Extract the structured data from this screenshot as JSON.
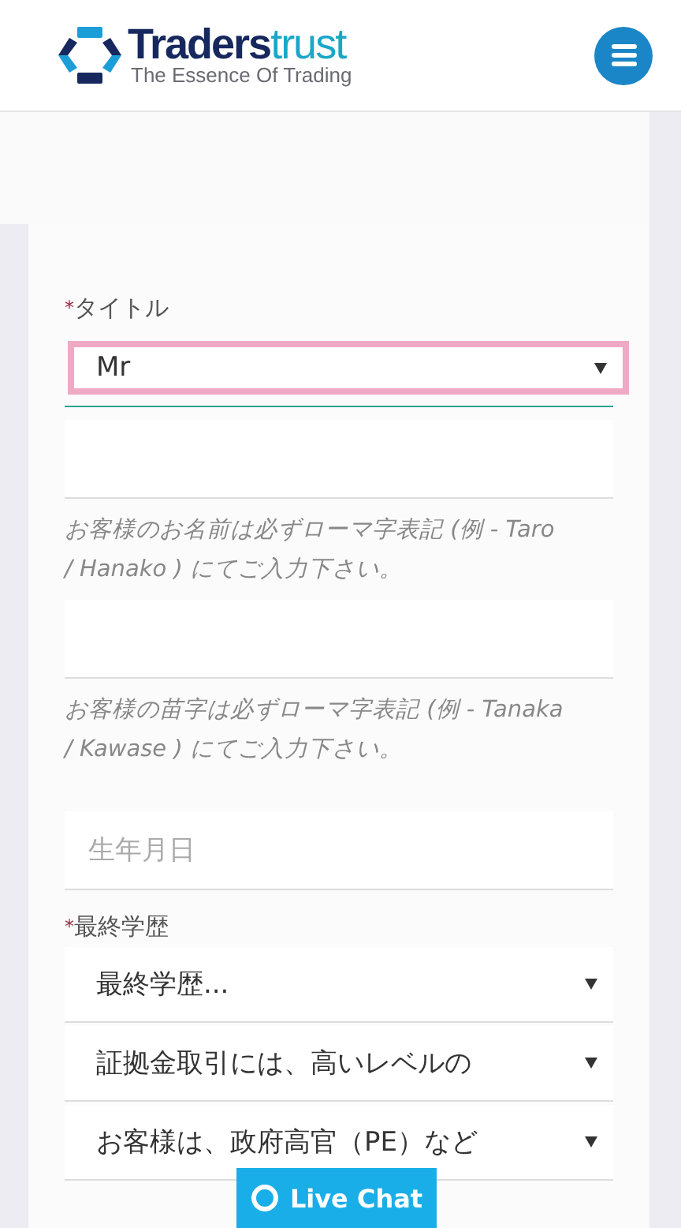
{
  "header": {
    "logo": {
      "name_main": "Traders",
      "name_accent": "trust",
      "tagline": "The Essence Of Trading"
    }
  },
  "form": {
    "fields": [
      {
        "kind": "label",
        "mark": "*",
        "text": "タイトル"
      },
      {
        "kind": "select",
        "value": "Mr",
        "focused": true
      },
      {
        "kind": "input"
      },
      {
        "kind": "hint",
        "text": "お客様のお名前は必ずローマ字表記 (例 - Taro / Hanako ) にてご入力下さい。"
      },
      {
        "kind": "input"
      },
      {
        "kind": "hint",
        "text": "お客様の苗字は必ずローマ字表記 (例 - Tanaka / Kawase ) にてご入力下さい。"
      },
      {
        "kind": "input",
        "placeholder": "生年月日"
      },
      {
        "kind": "label",
        "mark": "*",
        "text": "最終学歴"
      },
      {
        "kind": "select",
        "value": "最終学歴...",
        "focused": false
      },
      {
        "kind": "select",
        "value": "証拠金取引には、高いレベルの",
        "focused": false
      },
      {
        "kind": "select",
        "value": "お客様は、政府高官（PE）など",
        "focused": false
      }
    ]
  },
  "live_chat": {
    "label": "Live Chat"
  }
}
